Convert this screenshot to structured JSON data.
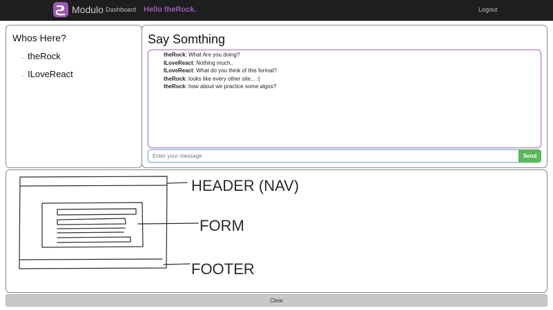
{
  "navbar": {
    "brand": "Modulo",
    "dashboard_link": "Dashboard",
    "greeting": "Hello theRock.",
    "logout_link": "Logout",
    "accent": "#9b59b6"
  },
  "who": {
    "title": "Whos Here?",
    "users": [
      {
        "name": "theRock"
      },
      {
        "name": "ILoveReact"
      }
    ]
  },
  "chat": {
    "title": "Say Somthing",
    "messages": [
      {
        "user": "theRock",
        "text": ": What Are you doing?"
      },
      {
        "user": "ILoveReact",
        "text": ": Nothing much.."
      },
      {
        "user": "ILoveReact",
        "text": ": What do you think of this format?"
      },
      {
        "user": "theRock",
        "text": ": looks like every other site... :("
      },
      {
        "user": "theRock",
        "text": ": how about we practice some algos?"
      }
    ],
    "input_placeholder": "Enter your message",
    "send_label": "Send"
  },
  "canvas": {
    "labels": {
      "header": "HEADER (NAV)",
      "form": "FORM",
      "footer": "FOOTER"
    }
  },
  "clear_label": "Clear"
}
